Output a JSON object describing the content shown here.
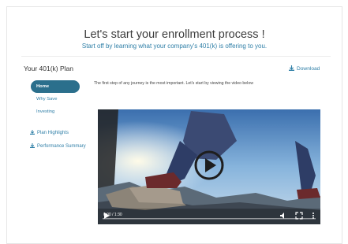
{
  "header": {
    "title": "Let's start your enrollment process !",
    "subtitle": "Start off by learning what your company's 401(k) is offering to you."
  },
  "plan": {
    "title": "Your 401(k) Plan",
    "download_label": "Download"
  },
  "nav": {
    "items": [
      {
        "label": "Home",
        "active": true
      },
      {
        "label": "Why Save",
        "active": false
      },
      {
        "label": "Investing",
        "active": false
      }
    ],
    "links": [
      {
        "label": "Plan Highlights"
      },
      {
        "label": "Performance Summary"
      }
    ]
  },
  "content": {
    "intro": "The first step of any journey is the most important. Let's start by viewing the video below"
  },
  "video": {
    "time": "0:00 / 1:30"
  },
  "colors": {
    "accent": "#2f7fa7",
    "nav_active": "#2b6f8c"
  },
  "icons": [
    "download-icon",
    "play-icon",
    "volume-icon",
    "fullscreen-icon",
    "more-icon"
  ]
}
